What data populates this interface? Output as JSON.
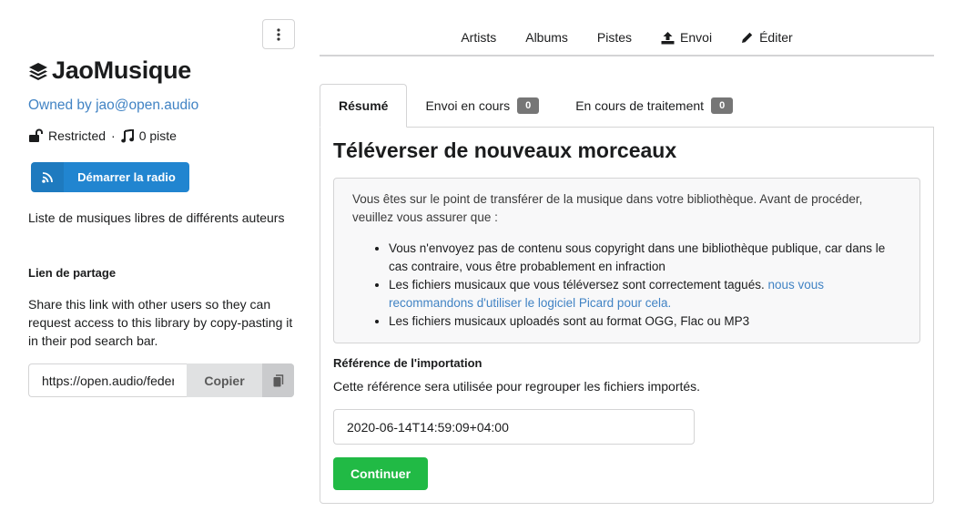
{
  "library": {
    "title": "JaoMusique",
    "owner": "Owned by jao@open.audio",
    "privacy": "Restricted",
    "separator": "·",
    "tracks": "0 piste",
    "radio_label": "Démarrer la radio",
    "description": "Liste de musiques libres de différents auteurs",
    "share_title": "Lien de partage",
    "share_help": "Share this link with other users so they can request access to this library by copy-pasting it in their pod search bar.",
    "share_url": "https://open.audio/federation/music/libraries/",
    "copy_label": "Copier"
  },
  "topmenu": {
    "artists": "Artists",
    "albums": "Albums",
    "tracks": "Pistes",
    "upload": "Envoi",
    "edit": "Éditer"
  },
  "tabs": {
    "summary": "Résumé",
    "uploading": "Envoi en cours",
    "uploading_count": "0",
    "processing": "En cours de traitement",
    "processing_count": "0"
  },
  "upload": {
    "title": "Téléverser de nouveaux morceaux",
    "notice_intro": "Vous êtes sur le point de transférer de la musique dans votre bibliothèque. Avant de procéder, veuillez vous assurer que :",
    "rule_1": "Vous n'envoyez pas de contenu sous copyright dans une bibliothèque publique, car dans le cas contraire, vous être probablement en infraction",
    "rule_2_text": "Les fichiers musicaux que vous téléversez sont correctement tagués.",
    "rule_2_link": "nous vous recommandons d'utiliser le logiciel Picard pour cela.",
    "rule_3": "Les fichiers musicaux uploadés sont au format OGG, Flac ou MP3",
    "ref_title": "Référence de l'importation",
    "ref_help": "Cette référence sera utilisée pour regrouper les fichiers importés.",
    "ref_value": "2020-06-14T14:59:09+04:00",
    "continue_label": "Continuer"
  },
  "colors": {
    "primary": "#2185d0",
    "success": "#21ba45",
    "link": "#4183c4"
  }
}
